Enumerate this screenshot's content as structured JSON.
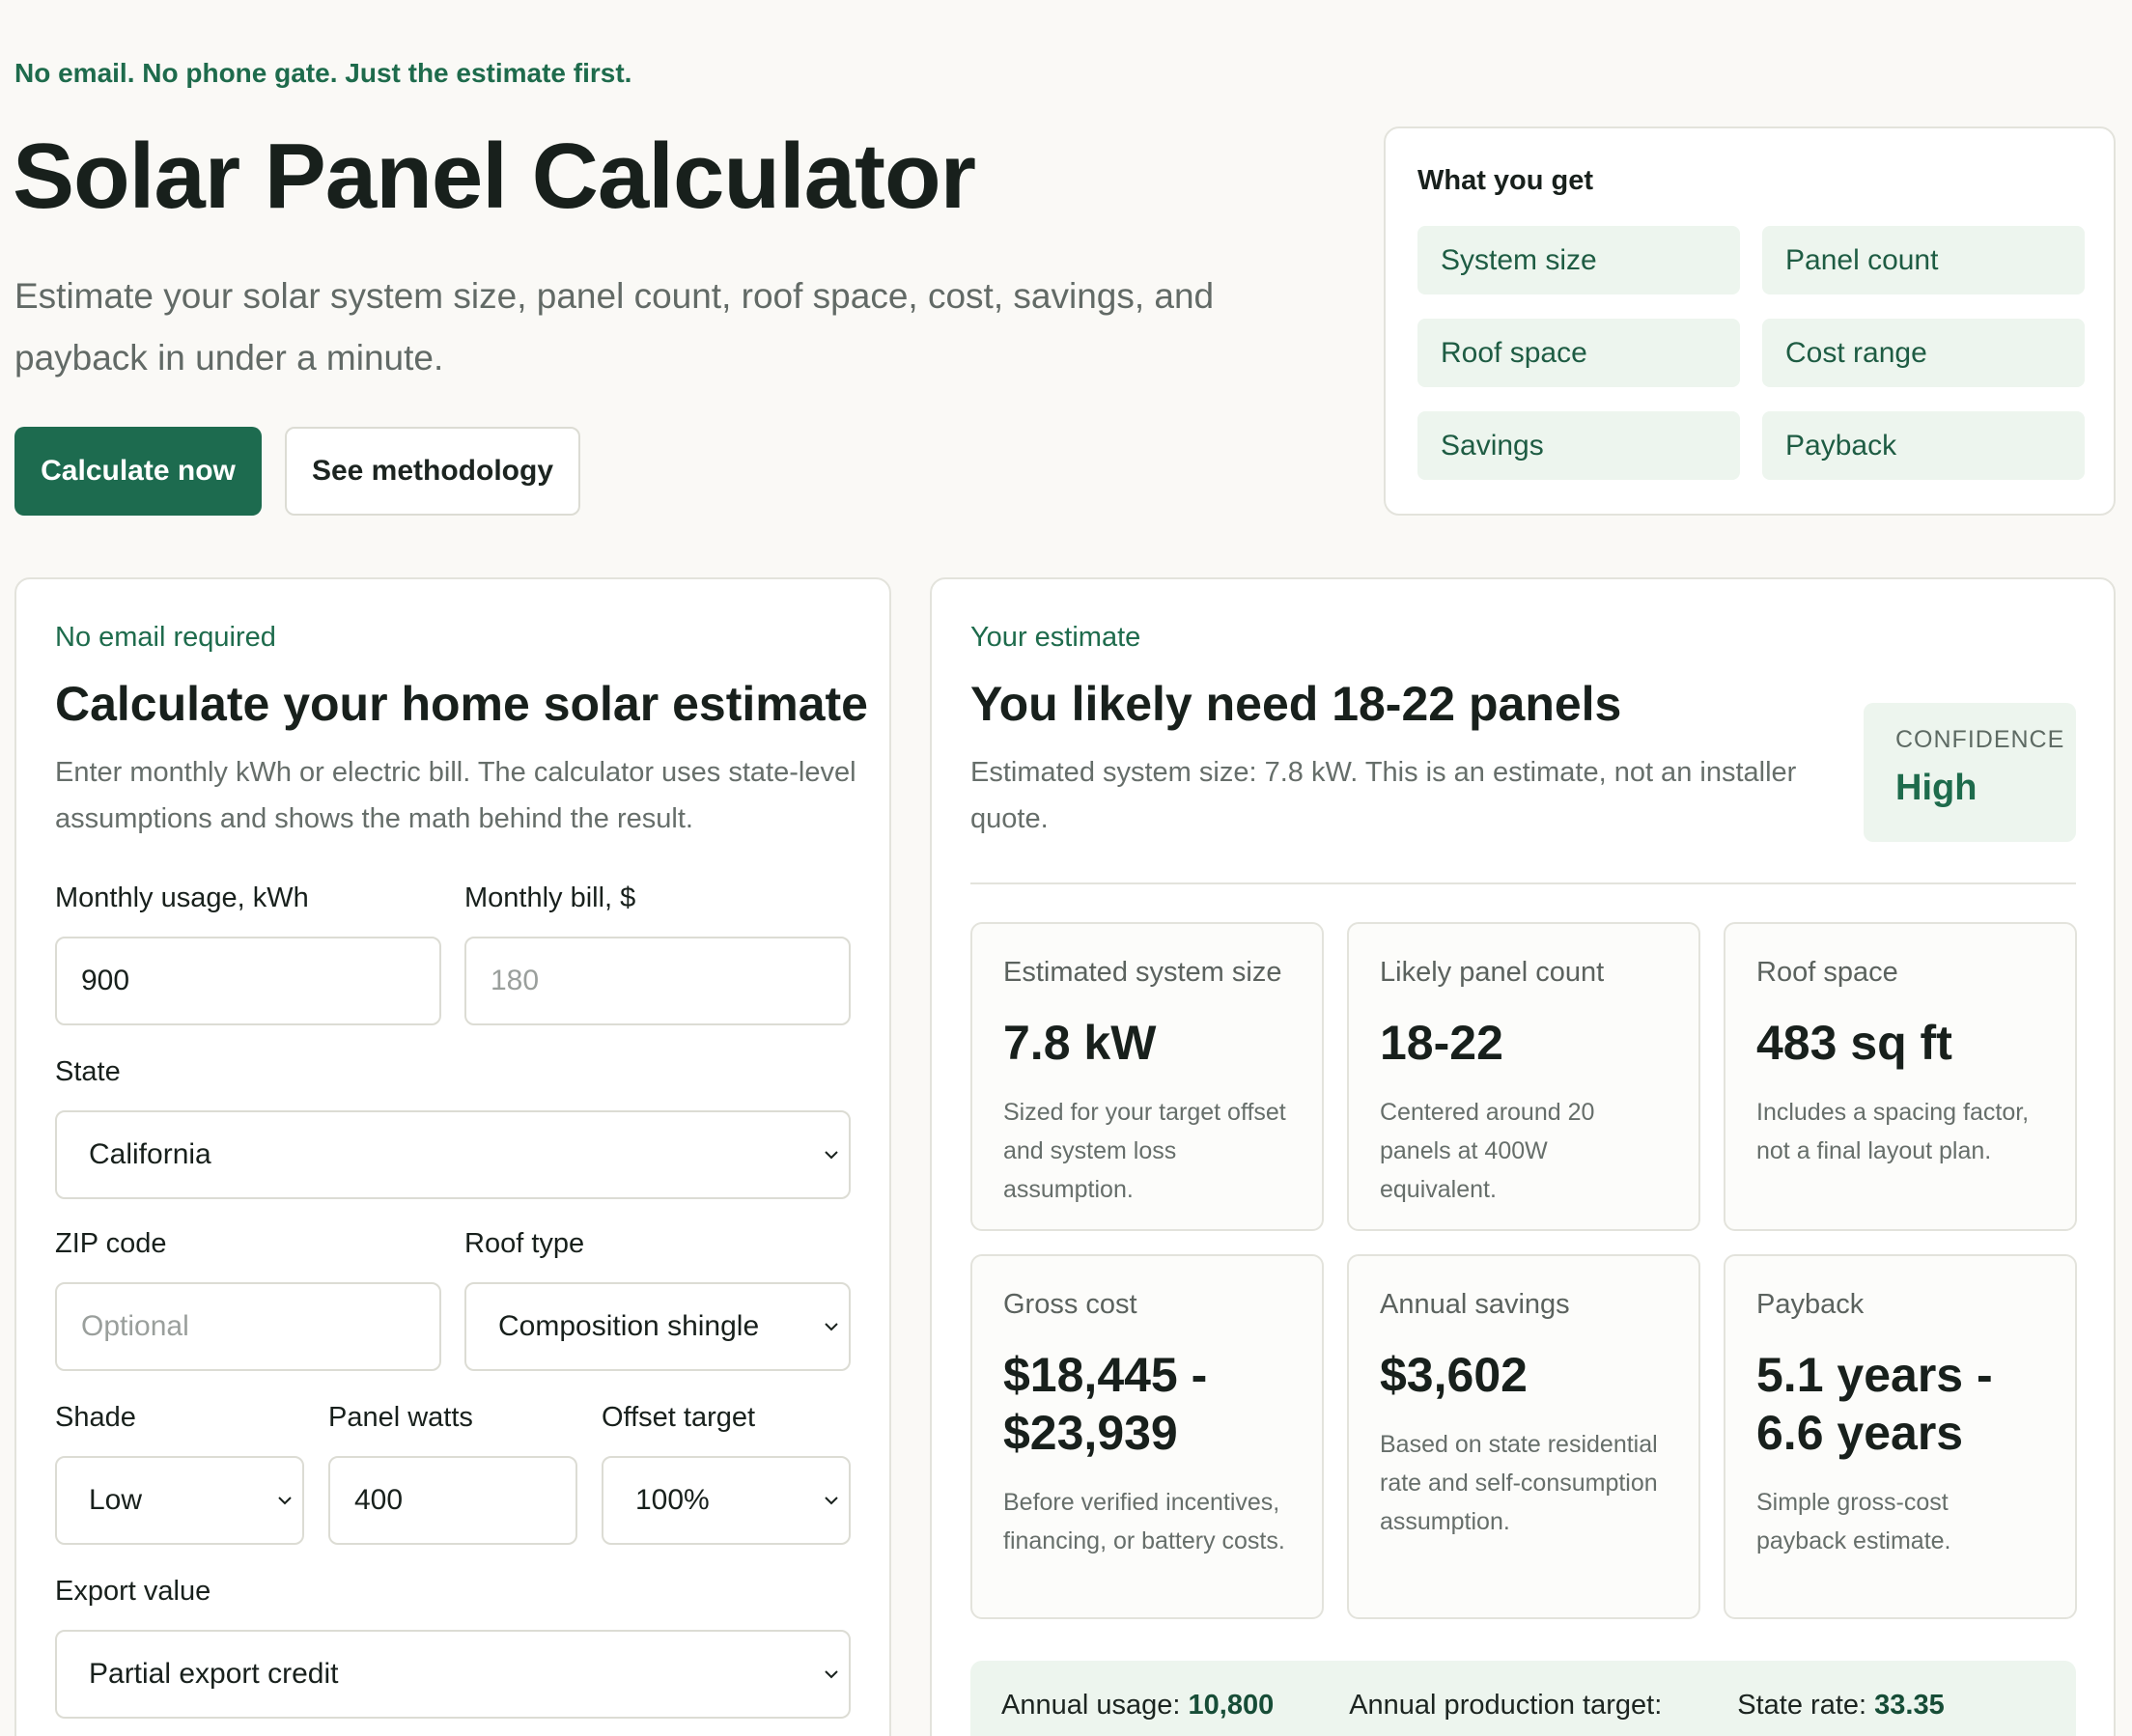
{
  "hero": {
    "tagline": "No email. No phone gate. Just the estimate first.",
    "title": "Solar Panel Calculator",
    "subtitle": "Estimate your solar system size, panel count, roof space, cost, savings, and payback in under a minute.",
    "primary_cta": "Calculate now",
    "secondary_cta": "See methodology"
  },
  "what_you_get": {
    "title": "What you get",
    "items": [
      "System size",
      "Panel count",
      "Roof space",
      "Cost range",
      "Savings",
      "Payback"
    ]
  },
  "form": {
    "kicker": "No email required",
    "title": "Calculate your home solar estimate",
    "description": "Enter monthly kWh or electric bill. The calculator uses state-level assumptions and shows the math behind the result.",
    "usage_label": "Monthly usage, kWh",
    "usage_value": "900",
    "bill_label": "Monthly bill, $",
    "bill_placeholder": "180",
    "state_label": "State",
    "state_value": "California",
    "zip_label": "ZIP code",
    "zip_placeholder": "Optional",
    "roof_label": "Roof type",
    "roof_value": "Composition shingle",
    "shade_label": "Shade",
    "shade_value": "Low",
    "watts_label": "Panel watts",
    "watts_value": "400",
    "offset_label": "Offset target",
    "offset_value": "100%",
    "export_label": "Export value",
    "export_value": "Partial export credit"
  },
  "estimate": {
    "kicker": "Your estimate",
    "title": "You likely need 18-22 panels",
    "description": "Estimated system size: 7.8 kW. This is an estimate, not an installer quote.",
    "confidence_label": "CONFIDENCE",
    "confidence_value": "High",
    "metrics": [
      {
        "label": "Estimated system size",
        "value": "7.8 kW",
        "note": "Sized for your target offset and system loss assumption."
      },
      {
        "label": "Likely panel count",
        "value": "18-22",
        "note": "Centered around 20 panels at 400W equivalent."
      },
      {
        "label": "Roof space",
        "value": "483 sq ft",
        "note": "Includes a spacing factor, not a final layout plan."
      },
      {
        "label": "Gross cost",
        "value": "$18,445 - $23,939",
        "note": "Before verified incentives, financing, or battery costs."
      },
      {
        "label": "Annual savings",
        "value": "$3,602",
        "note": "Based on state residential rate and self-consumption assumption."
      },
      {
        "label": "Payback",
        "value": "5.1 years - 6.6 years",
        "note": "Simple gross-cost payback estimate."
      }
    ],
    "summary": {
      "usage_label": "Annual usage:",
      "usage_value": "10,800",
      "production_label": "Annual production target:",
      "rate_label": "State rate:",
      "rate_value": "33.35"
    }
  }
}
